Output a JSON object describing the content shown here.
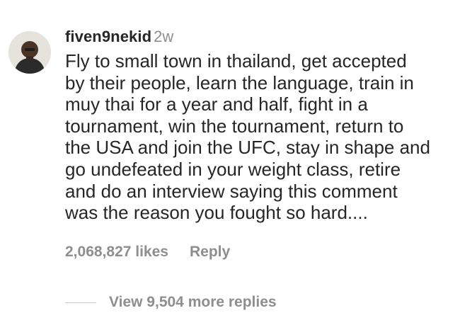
{
  "comment": {
    "username": "fiven9nekid",
    "timestamp": "2w",
    "text_lines": [
      "Fly to small town in thailand, get accepted",
      "by their people, learn the language, train in",
      "muy thai for a year and half, fight in a",
      "tournament, win the tournament, return to",
      "the USA and join the UFC, stay in shape and",
      "go undefeated in your weight class, retire",
      "and do an interview saying this comment",
      "was the reason you fought so hard...."
    ],
    "likes": "2,068,827 likes",
    "reply_label": "Reply",
    "view_replies_label": "View 9,504 more replies"
  },
  "icons": {
    "avatar": "profile-photo"
  },
  "colors": {
    "primary_text": "#262626",
    "secondary_text": "#8e8e8e",
    "divider": "#c7c7c7"
  }
}
